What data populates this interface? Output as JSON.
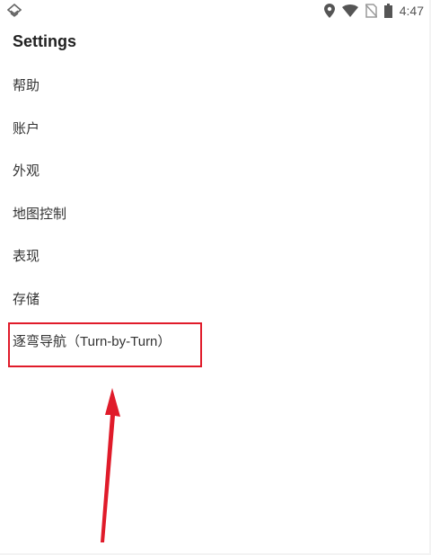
{
  "status_bar": {
    "time": "4:47",
    "icons": [
      "app-icon",
      "location-icon",
      "wifi-icon",
      "no-sim-icon",
      "battery-icon"
    ]
  },
  "page_title": "Settings",
  "settings_items": [
    {
      "label": "帮助"
    },
    {
      "label": "账户"
    },
    {
      "label": "外观"
    },
    {
      "label": "地图控制"
    },
    {
      "label": "表现"
    },
    {
      "label": "存储"
    },
    {
      "label": "逐弯导航（Turn-by-Turn）"
    }
  ],
  "annotation": {
    "highlight_color": "#e01b2a",
    "highlighted_item": "逐弯导航（Turn-by-Turn）"
  }
}
